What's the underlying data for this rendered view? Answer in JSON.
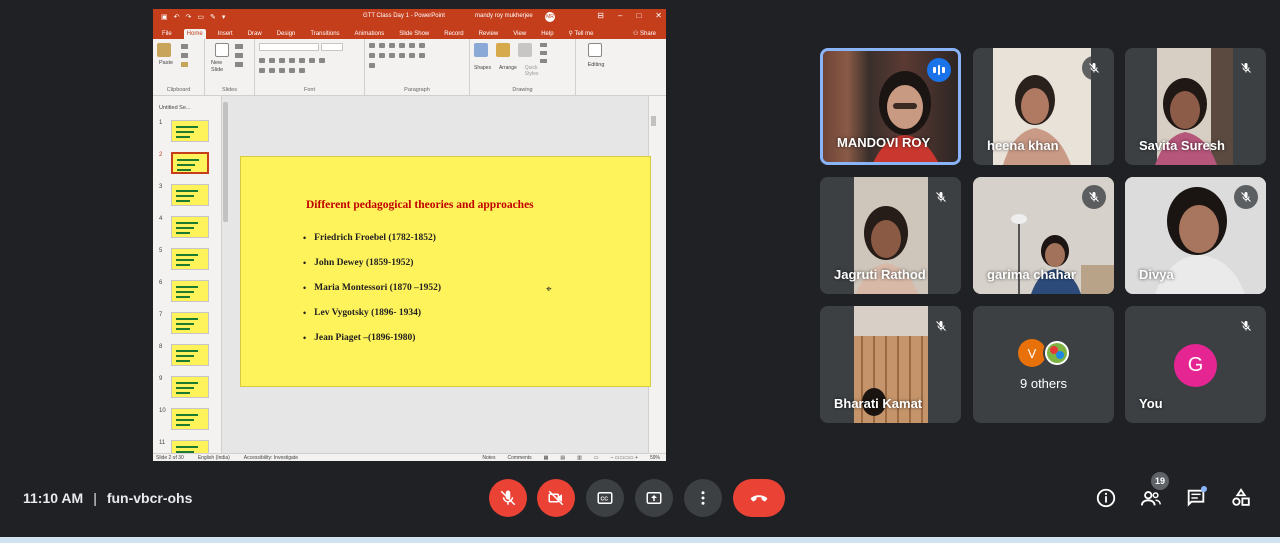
{
  "ppt": {
    "window_title": "GTT Class Day 1  -  PowerPoint",
    "user_name": "mandy roy mukherjee",
    "user_initials": "MR",
    "tabs": [
      "File",
      "Home",
      "Insert",
      "Draw",
      "Design",
      "Transitions",
      "Animations",
      "Slide Show",
      "Record",
      "Review",
      "View",
      "Help"
    ],
    "tell_me": "Tell me",
    "share": "Share",
    "groups": {
      "clipboard": "Clipboard",
      "paste": "Paste",
      "slides": "Slides",
      "new_slide": "New Slide",
      "font": "Font",
      "paragraph": "Paragraph",
      "drawing": "Drawing",
      "shapes": "Shapes",
      "arrange": "Arrange",
      "quick_styles": "Quick Styles",
      "editing": "Editing"
    },
    "section_label": "Untitled Se...",
    "thumb_numbers": [
      "1",
      "2",
      "3",
      "4",
      "5",
      "6",
      "7",
      "8",
      "9",
      "10",
      "11"
    ],
    "active_thumb": 2,
    "status": {
      "slide_of": "Slide 2 of 30",
      "language": "English (India)",
      "accessibility": "Accessibility: Investigate",
      "notes": "Notes",
      "comments": "Comments",
      "zoom": "59%"
    }
  },
  "slide": {
    "title": "Different pedagogical theories and approaches",
    "bullets": [
      "Friedrich Froebel (1782-1852)",
      "John Dewey (1859-1952)",
      "Maria Montessori (1870 –1952)",
      "Lev Vygotsky  (1896- 1934)",
      "Jean Piaget –(1896-1980)"
    ],
    "bg_color": "#fff35c",
    "title_color": "#c00000"
  },
  "participants": [
    {
      "name": "MANDOVI ROY",
      "speaking": true
    },
    {
      "name": "heena khan",
      "muted": true
    },
    {
      "name": "Savita Suresh",
      "muted": true
    },
    {
      "name": "Jagruti Rathod",
      "muted": true
    },
    {
      "name": "garima chahar",
      "muted": true
    },
    {
      "name": "Divya",
      "muted": true
    },
    {
      "name": "Bharati Kamat",
      "muted": true
    }
  ],
  "others_tile": {
    "label": "9 others",
    "avatar_letter": "V"
  },
  "you_tile": {
    "label": "You",
    "avatar_letter": "G"
  },
  "meeting": {
    "time": "11:10 AM",
    "separator": "|",
    "code": "fun-vbcr-ohs",
    "participant_count": "19"
  },
  "controls": {
    "mic": "mic-off-icon",
    "cam": "videocam-off-icon",
    "captions": "closed-captions-icon",
    "present": "present-screen-icon",
    "more": "more-vert-icon",
    "leave": "call-end-icon"
  },
  "colors": {
    "meet_bg": "#202124",
    "tile_bg": "#3c4043",
    "danger": "#ea4335",
    "ppt_brand": "#c43e1c",
    "speaking_ring": "#8ab4f8"
  }
}
